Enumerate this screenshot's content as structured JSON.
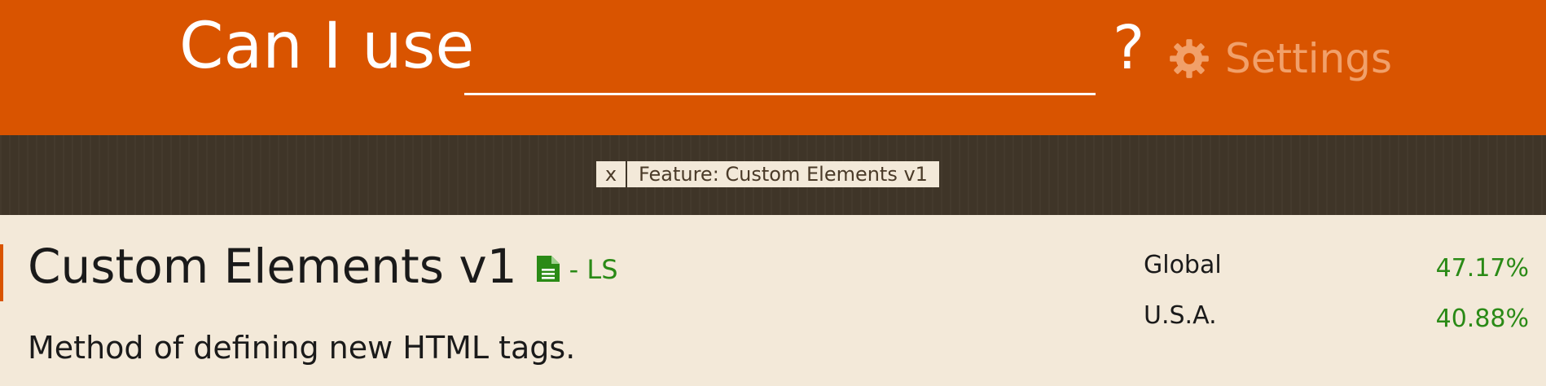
{
  "header": {
    "brand": "Can I use",
    "search_value": "",
    "question_mark": "?",
    "settings_label": "Settings",
    "settings_icon": "gear-icon"
  },
  "filter": {
    "remove_label": "x",
    "label": "Feature: Custom Elements v1"
  },
  "feature": {
    "title": "Custom Elements v1",
    "spec_icon": "document-icon",
    "spec_status": "- LS",
    "description": "Method of defining new HTML tags."
  },
  "usage": [
    {
      "region": "Global",
      "percent": "47.17%"
    },
    {
      "region": "U.S.A.",
      "percent": "40.88%"
    }
  ],
  "colors": {
    "header_bg": "#d95400",
    "filterbar_bg": "#3f3528",
    "page_bg": "#f3e9d9",
    "support_green": "#2a8a16",
    "settings_text": "#f1a06a"
  }
}
